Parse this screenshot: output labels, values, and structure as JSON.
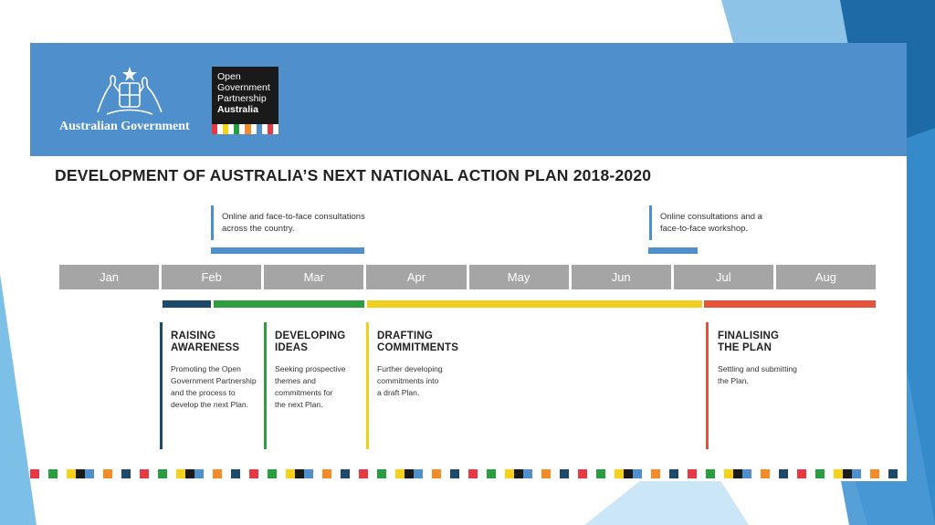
{
  "banner": {
    "government_name": "Australian Government",
    "ogp_logo_lines": [
      "Open",
      "Government",
      "Partnership",
      "Australia"
    ],
    "ogp_stripe_colors": [
      "#e63946",
      "#ffffff",
      "#f7d21c",
      "#ffffff",
      "#2a9d3f",
      "#ffffff",
      "#f28c28",
      "#ffffff",
      "#4f8fcc",
      "#ffffff",
      "#e63946",
      "#ffffff"
    ]
  },
  "title": "DEVELOPMENT OF AUSTRALIA’S NEXT NATIONAL ACTION PLAN 2018-2020",
  "consultations": [
    {
      "text": "Online and face-to-face consultations\nacross the country."
    },
    {
      "text": "Online consultations and a\nface-to-face workshop."
    }
  ],
  "months": [
    "Jan",
    "Feb",
    "Mar",
    "Apr",
    "May",
    "Jun",
    "Jul",
    "Aug"
  ],
  "phases": [
    {
      "title": "RAISING\nAWARENESS",
      "description": "Promoting the Open\nGovernment Partnership\nand the process to\ndevelop the next Plan.",
      "color": "#1d4a6b"
    },
    {
      "title": "DEVELOPING\nIDEAS",
      "description": "Seeking prospective\nthemes and\ncommitments for\nthe next Plan.",
      "color": "#2e9e3e"
    },
    {
      "title": "DRAFTING\nCOMMITMENTS",
      "description": "Further developing\ncommitments into\na draft Plan.",
      "color": "#f2cf1d"
    },
    {
      "title": "FINALISING\nTHE PLAN",
      "description": "Settling and submitting\nthe Plan.",
      "color": "#e5533a"
    }
  ],
  "colors": {
    "banner": "#4f8fcc",
    "month_cell": "#a5a5a5",
    "background_accent": "#3f92d2"
  }
}
